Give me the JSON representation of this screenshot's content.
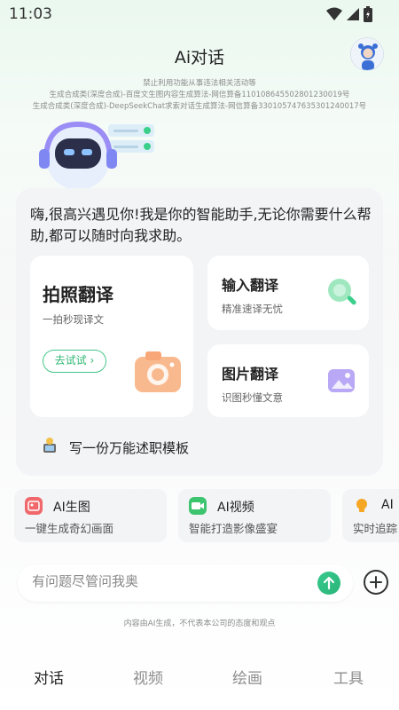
{
  "status_bar": {
    "time": "11:03"
  },
  "header": {
    "title": "Ai对话"
  },
  "notices": [
    "禁止利用功能从事违法相关活动等",
    "生成合成类(深度合成)-百度文生图内容生成算法-网信算备110108645502801230019号",
    "生成合成类(深度合成)-DeepSeekChat求索对话生成算法-网信算备330105747635301240017号"
  ],
  "chat_card": {
    "greeting": "嗨,很高兴遇见你!我是你的智能助手,无论你需要什么帮助,都可以随时向我求助。",
    "photo_translate": {
      "title": "拍照翻译",
      "subtitle": "一拍秒现译文",
      "button": "去试试"
    },
    "input_translate": {
      "title": "输入翻译",
      "subtitle": "精准速译无忧"
    },
    "image_translate": {
      "title": "图片翻译",
      "subtitle": "识图秒懂文意"
    },
    "template_suggestion": "写一份万能述职模板"
  },
  "features": [
    {
      "title": "AI生图",
      "subtitle": "一键生成奇幻画面",
      "color": "#f0686b"
    },
    {
      "title": "AI视频",
      "subtitle": "智能打造影像盛宴",
      "color": "#3cc46e"
    },
    {
      "title": "AI",
      "subtitle": "实时追踪",
      "color": "#f5a623"
    }
  ],
  "input": {
    "placeholder": "有问题尽管问我奥"
  },
  "disclaimer": "内容由AI生成，不代表本公司的态度和观点",
  "tabs": [
    {
      "label": "对话",
      "active": true
    },
    {
      "label": "视频",
      "active": false
    },
    {
      "label": "绘画",
      "active": false
    },
    {
      "label": "工具",
      "active": false
    }
  ],
  "colors": {
    "accent": "#2fb774",
    "card_bg": "#f3f4f6"
  }
}
